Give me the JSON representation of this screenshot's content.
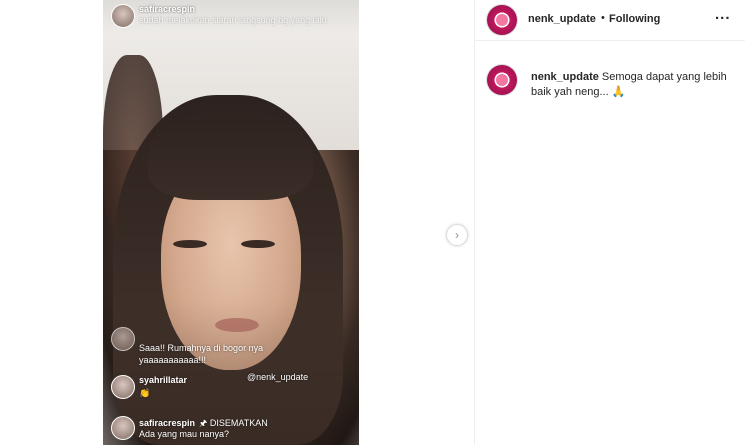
{
  "media": {
    "top_comment": {
      "username": "safiracrespin",
      "text": "sudah melakukan siaran langsung bg yang lalu"
    },
    "comments": [
      {
        "username": "",
        "text": "Saaa!! Rumahnya di bogor nya"
      },
      {
        "username": "",
        "text": "yaaaaaaaaaaa!!!"
      },
      {
        "username": "syahrillatar",
        "text": "👏"
      },
      {
        "username": "safiracrespin",
        "pinned_label": "🖈 DISEMATKAN",
        "text": "Ada yang mau nanya?"
      }
    ],
    "tag": "@nenk_update"
  },
  "post": {
    "username": "nenk_update",
    "separator": "•",
    "follow_status": "Following",
    "more": "...",
    "caption_user": "nenk_update",
    "caption_text": "Semoga dapat yang lebih baik yah neng... 🙏"
  },
  "icons": {
    "next": "chevron-right-icon",
    "more": "more-options-icon"
  },
  "colors": {
    "text": "#262626",
    "border": "#efefef"
  }
}
